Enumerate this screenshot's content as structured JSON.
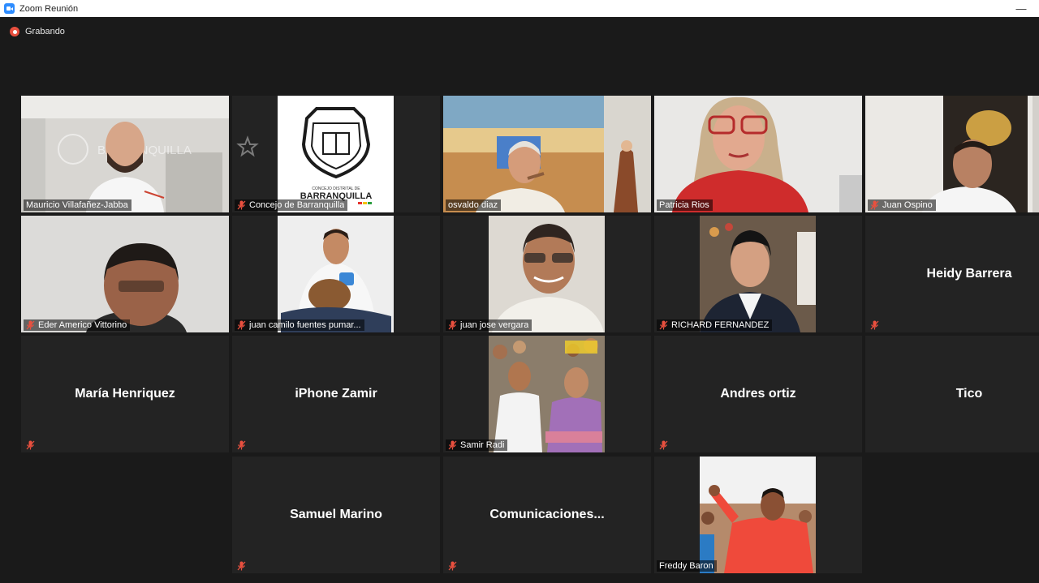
{
  "window": {
    "title": "Zoom Reunión",
    "minimize": "—"
  },
  "recording": {
    "label": "Grabando"
  },
  "participants": [
    {
      "name": "Mauricio Villafañez-Jabba",
      "muted": false,
      "video": true
    },
    {
      "name": "Concejo de Barranquilla",
      "muted": true,
      "video": true
    },
    {
      "name": "osvaldo diaz",
      "muted": false,
      "video": true
    },
    {
      "name": "Patricia Rios",
      "muted": false,
      "video": true,
      "active": true
    },
    {
      "name": "Juan Ospino",
      "muted": true,
      "video": true
    },
    {
      "name": "Eder Americo Vittorino",
      "muted": true,
      "video": true
    },
    {
      "name": "juan camilo fuentes pumar...",
      "muted": true,
      "video": true
    },
    {
      "name": "juan jose vergara",
      "muted": true,
      "video": true
    },
    {
      "name": "RICHARD FERNANDEZ",
      "muted": true,
      "video": true
    },
    {
      "name": "Heidy Barrera",
      "muted": true,
      "video": false
    },
    {
      "name": "María Henriquez",
      "muted": true,
      "video": false
    },
    {
      "name": "iPhone Zamir",
      "muted": true,
      "video": false
    },
    {
      "name": "Samir Radi",
      "muted": true,
      "video": true
    },
    {
      "name": "Andres ortiz",
      "muted": true,
      "video": false
    },
    {
      "name": "Tico",
      "muted": false,
      "video": false
    },
    {
      "name": "Samuel Marino",
      "muted": true,
      "video": false
    },
    {
      "name": "Comunicaciones...",
      "muted": true,
      "video": false
    },
    {
      "name": "Freddy Baron",
      "muted": false,
      "video": true
    }
  ],
  "logo": {
    "line1": "CONCEJO DISTRITAL DE",
    "line2": "BARRANQUILLA",
    "watermark": "BARRANQUILLA"
  },
  "colors": {
    "active_speaker": "#c6e05a",
    "muted_icon": "#e9503f",
    "recording": "#e9503f"
  }
}
